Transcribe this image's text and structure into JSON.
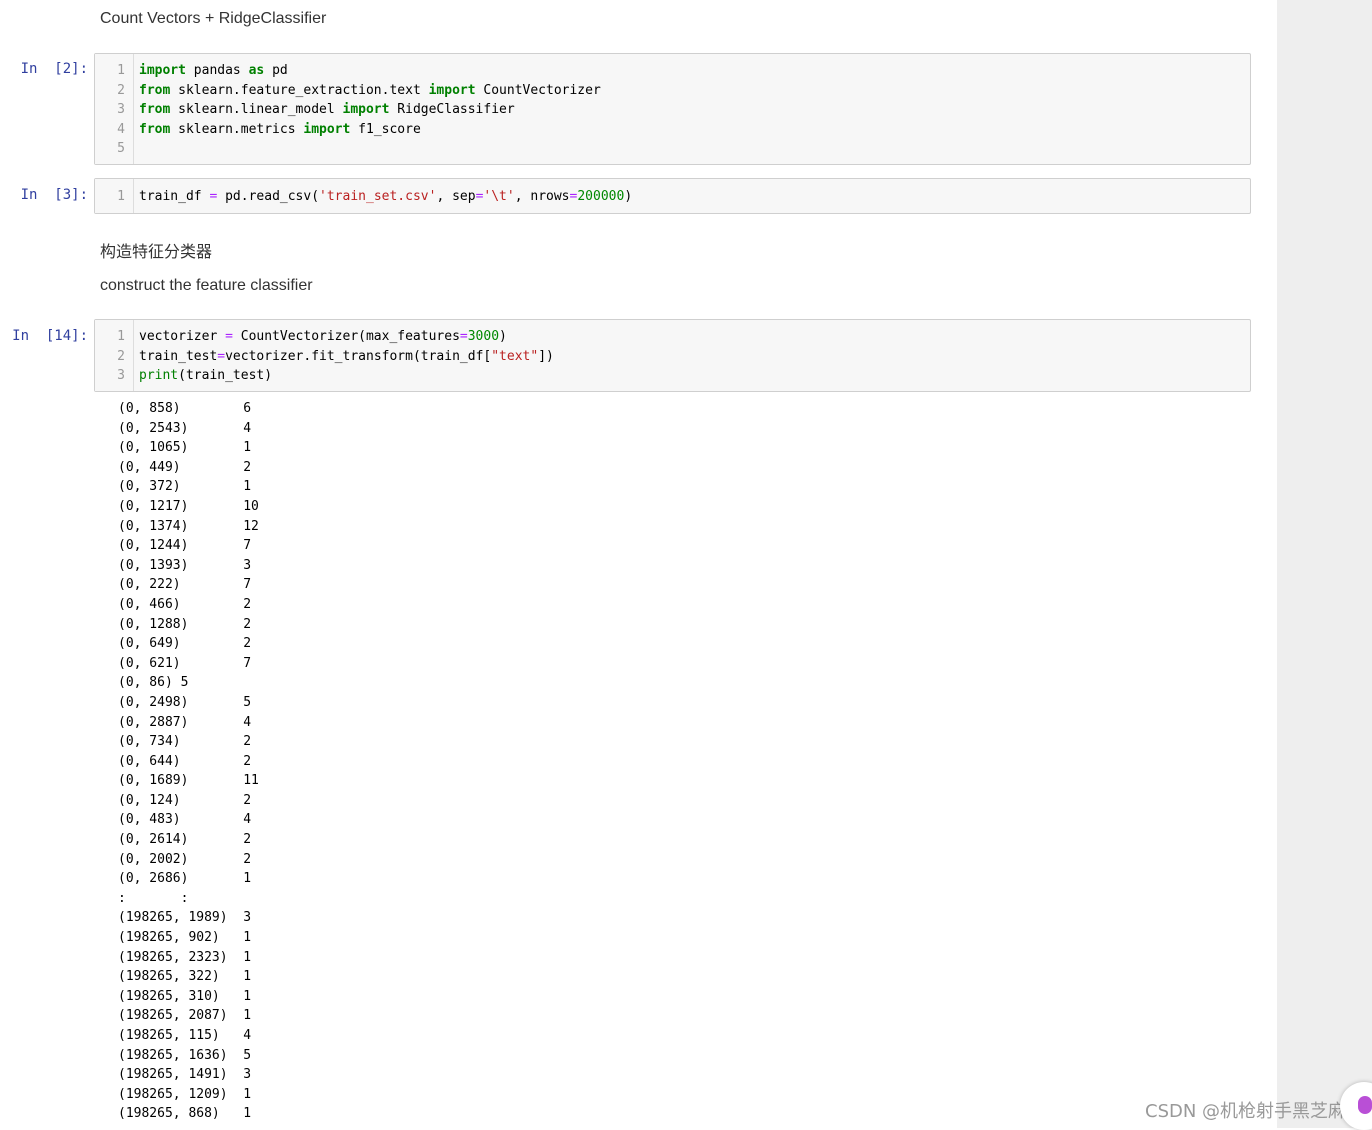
{
  "markdown": {
    "heading1": "Count Vectors + RidgeClassifier",
    "heading2_zh": "构造特征分类器",
    "heading2_en": "construct the feature classifier"
  },
  "cells": [
    {
      "prompt": "In  [2]:",
      "line_numbers": [
        "1",
        "2",
        "3",
        "4",
        "5"
      ],
      "lines": [
        [
          {
            "t": "import",
            "c": "kw"
          },
          {
            "t": " pandas ",
            "c": ""
          },
          {
            "t": "as",
            "c": "kw"
          },
          {
            "t": " pd",
            "c": ""
          }
        ],
        [
          {
            "t": "from",
            "c": "kw"
          },
          {
            "t": " sklearn.feature_extraction.text ",
            "c": ""
          },
          {
            "t": "import",
            "c": "kw"
          },
          {
            "t": " CountVectorizer",
            "c": ""
          }
        ],
        [
          {
            "t": "from",
            "c": "kw"
          },
          {
            "t": " sklearn.linear_model ",
            "c": ""
          },
          {
            "t": "import",
            "c": "kw"
          },
          {
            "t": " RidgeClassifier",
            "c": ""
          }
        ],
        [
          {
            "t": "from",
            "c": "kw"
          },
          {
            "t": " sklearn.metrics ",
            "c": ""
          },
          {
            "t": "import",
            "c": "kw"
          },
          {
            "t": " f1_score",
            "c": ""
          }
        ],
        []
      ]
    },
    {
      "prompt": "In  [3]:",
      "line_numbers": [
        "1"
      ],
      "lines": [
        [
          {
            "t": "train_df ",
            "c": ""
          },
          {
            "t": "=",
            "c": "op"
          },
          {
            "t": " pd.read_csv(",
            "c": ""
          },
          {
            "t": "'train_set.csv'",
            "c": "str"
          },
          {
            "t": ", sep",
            "c": ""
          },
          {
            "t": "=",
            "c": "op"
          },
          {
            "t": "'\\t'",
            "c": "str"
          },
          {
            "t": ", nrows",
            "c": ""
          },
          {
            "t": "=",
            "c": "op"
          },
          {
            "t": "200000",
            "c": "num"
          },
          {
            "t": ")",
            "c": ""
          }
        ]
      ]
    },
    {
      "prompt": "In  [14]:",
      "line_numbers": [
        "1",
        "2",
        "3"
      ],
      "lines": [
        [
          {
            "t": "vectorizer ",
            "c": ""
          },
          {
            "t": "=",
            "c": "op"
          },
          {
            "t": " CountVectorizer(max_features",
            "c": ""
          },
          {
            "t": "=",
            "c": "op"
          },
          {
            "t": "3000",
            "c": "num"
          },
          {
            "t": ")",
            "c": ""
          }
        ],
        [
          {
            "t": "train_test",
            "c": ""
          },
          {
            "t": "=",
            "c": "op"
          },
          {
            "t": "vectorizer.fit_transform(train_df[",
            "c": ""
          },
          {
            "t": "\"text\"",
            "c": "str"
          },
          {
            "t": "])",
            "c": ""
          }
        ],
        [
          {
            "t": "print",
            "c": "bi"
          },
          {
            "t": "(train_test)",
            "c": ""
          }
        ]
      ]
    }
  ],
  "output_lines": [
    "(0, 858)\t6",
    "(0, 2543)\t4",
    "(0, 1065)\t1",
    "(0, 449)\t2",
    "(0, 372)\t1",
    "(0, 1217)\t10",
    "(0, 1374)\t12",
    "(0, 1244)\t7",
    "(0, 1393)\t3",
    "(0, 222)\t7",
    "(0, 466)\t2",
    "(0, 1288)\t2",
    "(0, 649)\t2",
    "(0, 621)\t7",
    "(0, 86)\t5",
    "(0, 2498)\t5",
    "(0, 2887)\t4",
    "(0, 734)\t2",
    "(0, 644)\t2",
    "(0, 1689)\t11",
    "(0, 124)\t2",
    "(0, 483)\t4",
    "(0, 2614)\t2",
    "(0, 2002)\t2",
    "(0, 2686)\t1",
    ":\t:",
    "(198265, 1989)\t3",
    "(198265, 902)\t1",
    "(198265, 2323)\t1",
    "(198265, 322)\t1",
    "(198265, 310)\t1",
    "(198265, 2087)\t1",
    "(198265, 115)\t4",
    "(198265, 1636)\t5",
    "(198265, 1491)\t3",
    "(198265, 1209)\t1",
    "(198265, 868)\t1"
  ],
  "watermark": "CSDN @机枪射手黑芝麻"
}
